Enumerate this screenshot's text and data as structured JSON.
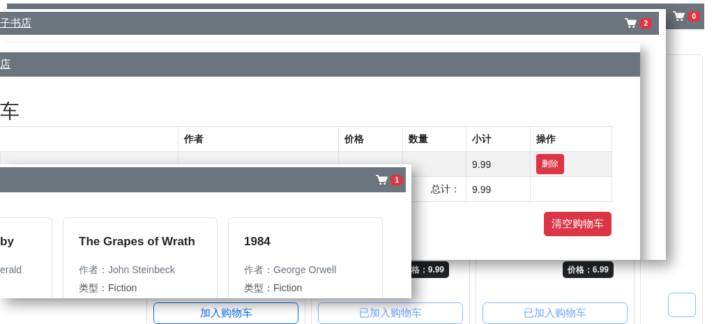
{
  "back_window": {
    "navbar": {
      "cart_count": "0"
    },
    "cards": [
      {
        "button": {
          "label": "加入购物车",
          "disabled": false
        }
      },
      {
        "price": "格：9.99",
        "button": {
          "label": "已加入购物车",
          "disabled": true
        }
      },
      {
        "price": "价格：6.99",
        "button": {
          "label": "已加入购物车",
          "disabled": true
        }
      }
    ]
  },
  "middle_window": {
    "navbar": {
      "brand": "子书店",
      "cart_count": "2"
    },
    "cart_page": {
      "navbar": {
        "brand": "店"
      },
      "heading": "车",
      "table": {
        "columns": [
          "作者",
          "价格",
          "数量",
          "小计",
          "操作"
        ],
        "rows": [
          {
            "subtotal": "9.99",
            "action": "删除"
          }
        ],
        "total": {
          "label": "总计：",
          "value": "9.99"
        }
      },
      "clear_button": "清空购物车"
    }
  },
  "front_window": {
    "navbar": {
      "cart_count": "1"
    },
    "cards": [
      {
        "title": "by",
        "author": "erald"
      },
      {
        "title": "The Grapes of Wrath",
        "author": "作者：John Steinbeck",
        "genre": "类型：Fiction"
      },
      {
        "title": "1984",
        "author": "作者：George Orwell",
        "genre": "类型：Fiction"
      }
    ]
  }
}
